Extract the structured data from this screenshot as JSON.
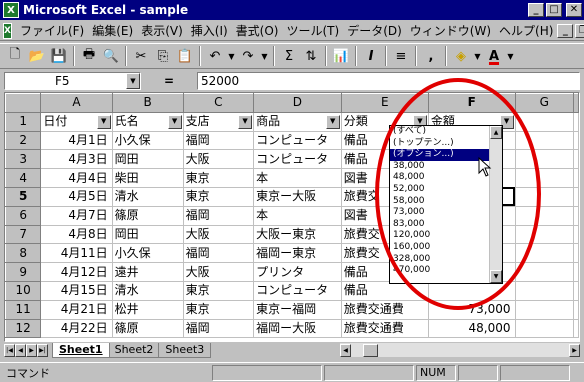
{
  "window": {
    "title": "Microsoft Excel - sample"
  },
  "menubar": {
    "items": [
      "ファイル(F)",
      "編集(E)",
      "表示(V)",
      "挿入(I)",
      "書式(O)",
      "ツール(T)",
      "データ(D)",
      "ウィンドウ(W)",
      "ヘルプ(H)"
    ]
  },
  "formula_bar": {
    "cell_ref": "F5",
    "equals": "=",
    "value": "52000"
  },
  "columns": [
    "A",
    "B",
    "C",
    "D",
    "E",
    "F",
    "G"
  ],
  "header_row": {
    "row_num": "1",
    "cells": [
      "日付",
      "氏名",
      "支店",
      "商品",
      "分類",
      "金額"
    ]
  },
  "rows": [
    {
      "row_num": "2",
      "cells": [
        "4月1日",
        "小久保",
        "福岡",
        "コンピュータ",
        "備品",
        ""
      ]
    },
    {
      "row_num": "3",
      "cells": [
        "4月3日",
        "岡田",
        "大阪",
        "コンピュータ",
        "備品",
        ""
      ]
    },
    {
      "row_num": "4",
      "cells": [
        "4月4日",
        "柴田",
        "東京",
        "本",
        "図書",
        ""
      ]
    },
    {
      "row_num": "5",
      "cells": [
        "4月5日",
        "清水",
        "東京",
        "東京ー大阪",
        "旅費交",
        ""
      ]
    },
    {
      "row_num": "6",
      "cells": [
        "4月7日",
        "篠原",
        "福岡",
        "本",
        "図書",
        ""
      ]
    },
    {
      "row_num": "7",
      "cells": [
        "4月8日",
        "岡田",
        "大阪",
        "大阪ー東京",
        "旅費交",
        ""
      ]
    },
    {
      "row_num": "8",
      "cells": [
        "4月11日",
        "小久保",
        "福岡",
        "福岡ー東京",
        "旅費交",
        ""
      ]
    },
    {
      "row_num": "9",
      "cells": [
        "4月12日",
        "遠井",
        "大阪",
        "プリンタ",
        "備品",
        ""
      ]
    },
    {
      "row_num": "10",
      "cells": [
        "4月15日",
        "清水",
        "東京",
        "コンピュータ",
        "備品",
        ""
      ]
    },
    {
      "row_num": "11",
      "cells": [
        "4月21日",
        "松井",
        "東京",
        "東京ー福岡",
        "旅費交通費",
        "73,000"
      ]
    },
    {
      "row_num": "12",
      "cells": [
        "4月22日",
        "篠原",
        "福岡",
        "福岡ー大阪",
        "旅費交通費",
        "48,000"
      ]
    }
  ],
  "autofilter_dropdown": {
    "items": [
      "(すべて)",
      "(トップテン...)",
      "(オプション...)",
      "38,000",
      "48,000",
      "52,000",
      "58,000",
      "73,000",
      "83,000",
      "120,000",
      "160,000",
      "328,000",
      "470,000"
    ],
    "highlighted_index": 2
  },
  "sheet_tabs": [
    "Sheet1",
    "Sheet2",
    "Sheet3"
  ],
  "active_sheet": "Sheet1",
  "status": {
    "mode": "コマンド",
    "num": "NUM"
  },
  "colors": {
    "titlebar": "#000080",
    "highlight": "#000080",
    "annotation": "#e00000",
    "chrome": "#c0c0c0"
  },
  "icons": [
    "excel-app-icon",
    "new-icon",
    "open-icon",
    "save-icon",
    "print-icon",
    "preview-icon",
    "cut-icon",
    "copy-icon",
    "paste-icon",
    "undo-icon",
    "redo-icon",
    "autosum-icon",
    "sort-icon",
    "chart-icon",
    "italic-icon",
    "align-icon",
    "comma-icon",
    "fill-color-icon",
    "font-color-icon"
  ]
}
